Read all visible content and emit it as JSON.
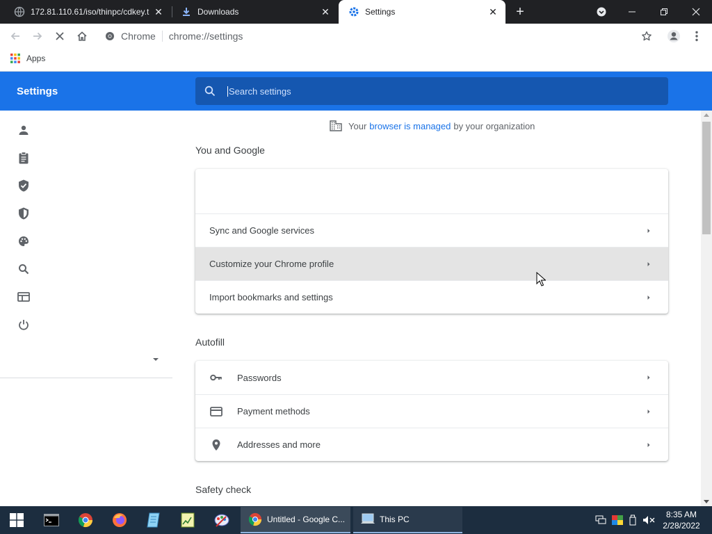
{
  "browser": {
    "tabs": [
      {
        "title": "172.81.110.61/iso/thinpc/cdkey.t",
        "icon": "globe-icon",
        "active": false
      },
      {
        "title": "Downloads",
        "icon": "download-icon",
        "active": false
      },
      {
        "title": "Settings",
        "icon": "settings-gear-icon",
        "active": true
      }
    ],
    "new_tab_label": "+",
    "omnibox": {
      "origin": "Chrome",
      "url": "chrome://settings"
    },
    "bookmarks": {
      "apps_label": "Apps"
    }
  },
  "settings": {
    "header_title": "Settings",
    "search_placeholder": "Search settings",
    "sidebar_icons": [
      "person-icon",
      "clipboard-icon",
      "shield-check-icon",
      "security-shield-icon",
      "palette-icon",
      "search-icon",
      "browser-window-icon",
      "power-icon"
    ],
    "managed": {
      "prefix": "Your",
      "link": "browser is managed",
      "suffix": "by your organization"
    },
    "sections": [
      {
        "title": "You and Google",
        "rows": [
          "",
          "Sync and Google services",
          "Customize your Chrome profile",
          "Import bookmarks and settings"
        ]
      },
      {
        "title": "Autofill",
        "rows": [
          {
            "label": "Passwords",
            "icon": "key-icon"
          },
          {
            "label": "Payment methods",
            "icon": "credit-card-icon"
          },
          {
            "label": "Addresses and more",
            "icon": "location-pin-icon"
          }
        ]
      },
      {
        "title": "Safety check",
        "rows": []
      }
    ]
  },
  "taskbar": {
    "tasks": [
      {
        "label": "Untitled - Google C...",
        "icon": "chrome-icon",
        "active": true
      },
      {
        "label": "This PC",
        "icon": "this-pc-icon",
        "active": false
      }
    ],
    "clock": {
      "time": "8:35 AM",
      "date": "2/28/2022"
    }
  },
  "colors": {
    "accent": "#1a73e8",
    "header": "#1a73e8",
    "tabstrip": "#202124",
    "taskbar": "#1c2d3f"
  }
}
